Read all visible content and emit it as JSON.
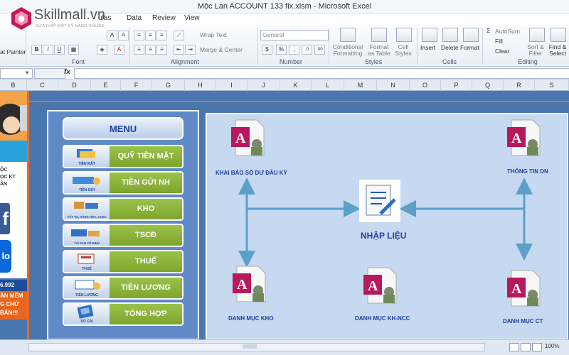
{
  "window": {
    "title": "Mộc Lan ACCOUNT 133 fix.xlsm  -  Microsoft Excel"
  },
  "watermark": {
    "brand": "Skillmall.vn",
    "tagline": "CỬA GIẢP MỘT KỸ NĂNG ONLINE"
  },
  "tabs": [
    "ulas",
    "Data",
    "Review",
    "View"
  ],
  "ribbon": {
    "clipboard": {
      "painter": "at Painter"
    },
    "font": {
      "label": "Font"
    },
    "alignment": {
      "wrap": "Wrap Text",
      "merge": "Merge & Center",
      "label": "Alignment"
    },
    "number": {
      "format": "General",
      "label": "Number"
    },
    "styles": {
      "conditional": "Conditional Formatting",
      "format_table": "Format as Table",
      "cell_styles": "Cell Styles",
      "label": "Styles"
    },
    "cells": {
      "insert": "Insert",
      "delete": "Delete",
      "format": "Format",
      "label": "Cells"
    },
    "editing": {
      "autosum": "AutoSum",
      "fill": "Fill",
      "clear": "Clear",
      "sort": "Sort & Filter",
      "find": "Find & Select",
      "label": "Editing"
    }
  },
  "formula_bar": {
    "fx": "fx"
  },
  "columns": [
    "B",
    "C",
    "D",
    "E",
    "F",
    "G",
    "H",
    "I",
    "J",
    "K",
    "L",
    "M",
    "N",
    "O",
    "P",
    "Q",
    "R",
    "S"
  ],
  "left_strip": {
    "t1": "ỘC",
    "t2": "ỌC KT",
    "t3": "ÂN",
    "t4": "6.992",
    "t5": "ẦN MỀM",
    "t6": "G CHỨ",
    "t7": "BÁN!!!"
  },
  "menu": {
    "title": "MENU",
    "items": [
      {
        "label": "QUỸ TIỀN MẶT",
        "caption": "TIỀN MẶT"
      },
      {
        "label": "TIỀN GỬI NH",
        "caption": "TIỀN GỬI"
      },
      {
        "label": "KHO",
        "caption": "VẬT TƯ, HÀNG HÓA, CCDC"
      },
      {
        "label": "TSCĐ",
        "caption": "TÀI SẢN CỐ ĐỊNH"
      },
      {
        "label": "THUẾ",
        "caption": "THUẾ"
      },
      {
        "label": "TIỀN LƯƠNG",
        "caption": "TIỀN LƯƠNG"
      },
      {
        "label": "TỔNG HỢP",
        "caption": "SỔ CÁI"
      }
    ]
  },
  "diagram": {
    "opening": "KHAI BÁO SỐ DƯ ĐẦU KỲ",
    "company": "THÔNG TIN DN",
    "entry": "NHẬP LIỆU",
    "warehouse": "DANH MỤC KHO",
    "customers": "DANH MỤC KH-NCC",
    "accounts": "DANH MỤC CT"
  },
  "status": {
    "zoom": "100%"
  }
}
